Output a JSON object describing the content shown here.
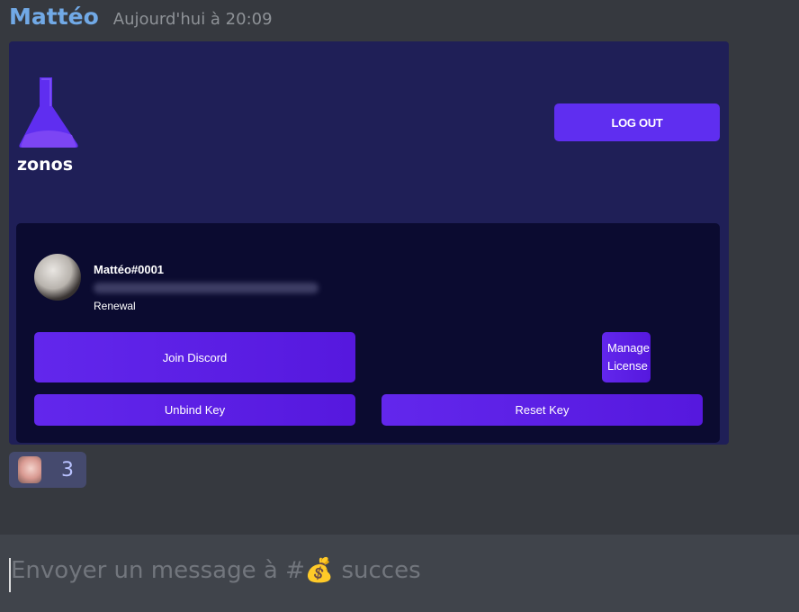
{
  "message": {
    "author": "Mattéo",
    "timestamp": "Aujourd'hui à 20:09"
  },
  "embed": {
    "logo_text": "zonos",
    "logout_label": "LOG OUT",
    "user": {
      "username": "Mattéo#0001",
      "plan": "Renewal"
    },
    "buttons": {
      "join": "Join Discord",
      "manage_line1": "Manage",
      "manage_line2": "License",
      "unbind": "Unbind Key",
      "reset": "Reset Key"
    }
  },
  "reaction": {
    "count": "3"
  },
  "composer": {
    "placeholder": "Envoyer un message à #💰 succes"
  },
  "colors": {
    "background": "#36393f",
    "author": "#71a9e6",
    "embed_bg": "#1f1f57",
    "panel_bg": "#0b0b30",
    "button": "#5f2ef0"
  }
}
